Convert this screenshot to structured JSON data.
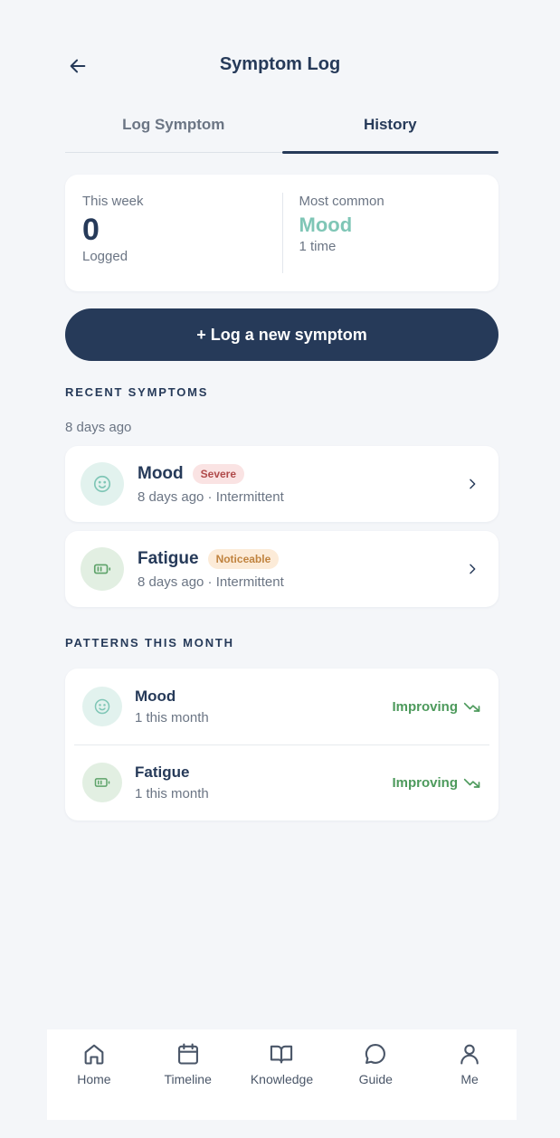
{
  "header": {
    "title": "Symptom Log"
  },
  "tabs": [
    {
      "label": "Log Symptom",
      "active": false
    },
    {
      "label": "History",
      "active": true
    }
  ],
  "summary": {
    "week_label": "This week",
    "week_value": "0",
    "week_sub": "Logged",
    "common_label": "Most common",
    "common_value": "Mood",
    "common_sub": "1 time"
  },
  "cta": {
    "label": "+ Log a new symptom"
  },
  "recent": {
    "title": "RECENT SYMPTOMS",
    "group_label": "8 days ago",
    "items": [
      {
        "name": "Mood",
        "badge": "Severe",
        "meta": "8 days ago · Intermittent",
        "icon": "smile-icon"
      },
      {
        "name": "Fatigue",
        "badge": "Noticeable",
        "meta": "8 days ago · Intermittent",
        "icon": "battery-icon"
      }
    ]
  },
  "patterns": {
    "title": "PATTERNS THIS MONTH",
    "items": [
      {
        "name": "Mood",
        "sub": "1 this month",
        "trend": "Improving",
        "icon": "smile-icon"
      },
      {
        "name": "Fatigue",
        "sub": "1 this month",
        "trend": "Improving",
        "icon": "battery-icon"
      }
    ]
  },
  "nav": [
    {
      "label": "Home",
      "icon": "home-icon"
    },
    {
      "label": "Timeline",
      "icon": "calendar-icon"
    },
    {
      "label": "Knowledge",
      "icon": "book-icon"
    },
    {
      "label": "Guide",
      "icon": "chat-icon"
    },
    {
      "label": "Me",
      "icon": "user-icon"
    }
  ],
  "colors": {
    "primary": "#263a59",
    "accent_teal": "#7fc6b6",
    "trend_green": "#4d9a5c",
    "background": "#f4f6f9"
  }
}
